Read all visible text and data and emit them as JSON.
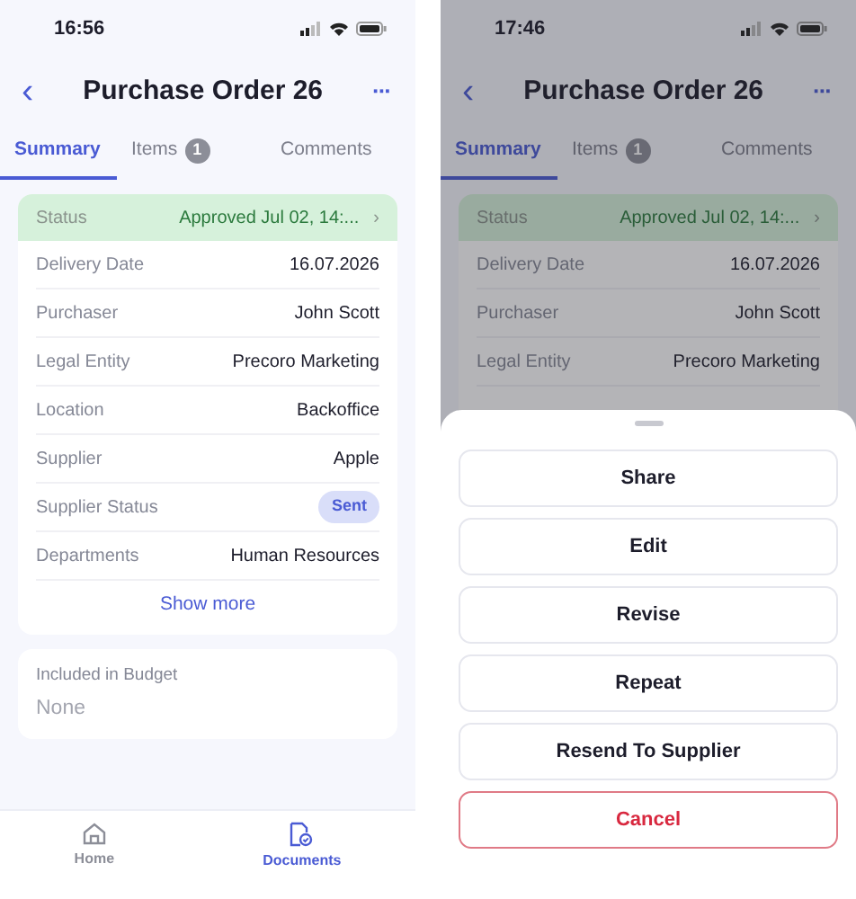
{
  "screens": [
    {
      "time": "16:56",
      "title": "Purchase Order 26",
      "back": "‹",
      "more": "···",
      "tabs": [
        {
          "label": "Summary",
          "selected": true
        },
        {
          "label": "Items",
          "count": "1",
          "selected": false
        },
        {
          "label": "Comments",
          "selected": false
        }
      ],
      "status": {
        "label": "Status",
        "value": "Approved Jul 02, 14:...",
        "chevron": "›"
      },
      "fields": [
        {
          "label": "Delivery Date",
          "value": "16.07.2026",
          "kind": "text"
        },
        {
          "label": "Purchaser",
          "value": "John Scott",
          "kind": "text"
        },
        {
          "label": "Legal Entity",
          "value": "Precoro Marketing",
          "kind": "text"
        },
        {
          "label": "Location",
          "value": "Backoffice",
          "kind": "text"
        },
        {
          "label": "Supplier",
          "value": "Apple",
          "kind": "text"
        },
        {
          "label": "Supplier Status",
          "value": "Sent",
          "kind": "badge"
        },
        {
          "label": "Departments",
          "value": "Human Resources",
          "kind": "text"
        }
      ],
      "show_more": "Show more",
      "budget": {
        "label": "Included in Budget",
        "value": "None"
      },
      "nav": [
        {
          "label": "Home",
          "kind": "home",
          "selected": false
        },
        {
          "label": "Documents",
          "kind": "documents",
          "selected": true
        }
      ]
    },
    {
      "time": "17:46",
      "title": "Purchase Order 26",
      "back": "‹",
      "more": "···",
      "tabs": [
        {
          "label": "Summary",
          "selected": true
        },
        {
          "label": "Items",
          "count": "1",
          "selected": false
        },
        {
          "label": "Comments",
          "selected": false
        }
      ],
      "status": {
        "label": "Status",
        "value": "Approved Jul 02, 14:...",
        "chevron": "›"
      },
      "fields": [
        {
          "label": "Delivery Date",
          "value": "16.07.2026",
          "kind": "text"
        },
        {
          "label": "Purchaser",
          "value": "John Scott",
          "kind": "text"
        },
        {
          "label": "Legal Entity",
          "value": "Precoro Marketing",
          "kind": "text"
        }
      ],
      "sheet": {
        "actions": [
          {
            "label": "Share",
            "kind": "default"
          },
          {
            "label": "Edit",
            "kind": "default"
          },
          {
            "label": "Revise",
            "kind": "default"
          },
          {
            "label": "Repeat",
            "kind": "default"
          },
          {
            "label": "Resend To Supplier",
            "kind": "default"
          },
          {
            "label": "Cancel",
            "kind": "destructive"
          }
        ]
      }
    }
  ]
}
